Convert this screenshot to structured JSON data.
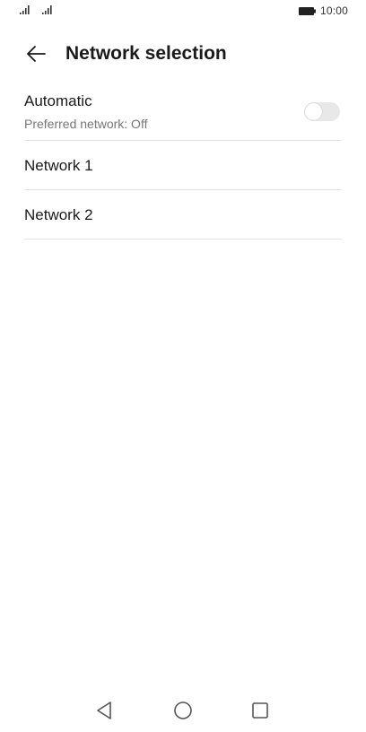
{
  "status_bar": {
    "time": "10:00",
    "icons": [
      "signal-icon",
      "signal-icon",
      "battery-icon"
    ]
  },
  "header": {
    "back_icon": "arrow-left-icon",
    "title": "Network selection"
  },
  "settings": {
    "automatic": {
      "label": "Automatic",
      "subtitle": "Preferred network: Off",
      "toggle_on": false
    },
    "networks": [
      {
        "label": "Network 1"
      },
      {
        "label": "Network 2"
      }
    ]
  },
  "nav_bar": {
    "icons": [
      "triangle-back-icon",
      "circle-home-icon",
      "square-recents-icon"
    ]
  }
}
